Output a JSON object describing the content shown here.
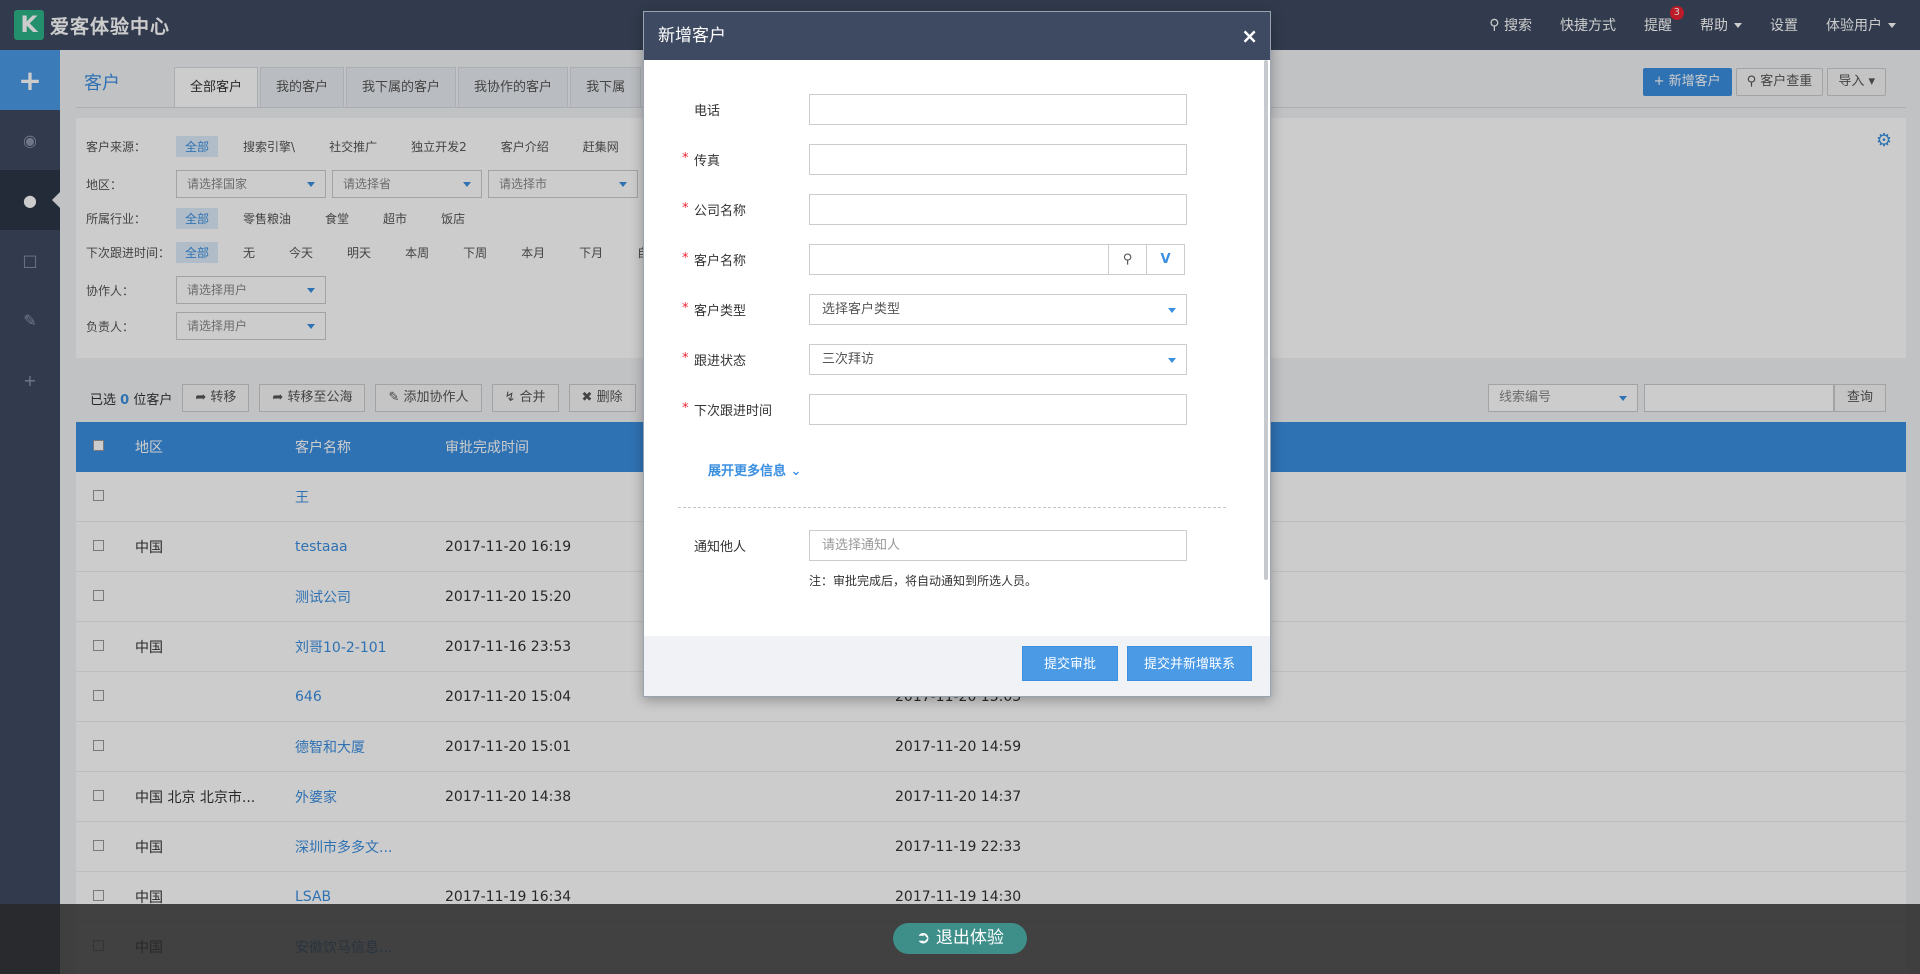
{
  "app": {
    "title": "爱客体验中心",
    "logo_letter": "K"
  },
  "topnav": {
    "search": "搜索",
    "shortcut": "快捷方式",
    "remind": "提醒",
    "remind_count": "3",
    "help": "帮助",
    "settings": "设置",
    "user": "体验用户"
  },
  "page": {
    "title": "客户",
    "tabs": [
      "全部客户",
      "我的客户",
      "我下属的客户",
      "我协作的客户",
      "我下属"
    ],
    "buttons": {
      "new": "新增客户",
      "dup": "客户查重",
      "import": "导入"
    }
  },
  "filters": {
    "source": {
      "label": "客户来源：",
      "options": [
        "全部",
        "搜索引擎\\",
        "社交推广",
        "独立开发2",
        "客户介绍",
        "赶集网"
      ]
    },
    "region": {
      "label": "地区：",
      "country": "请选择国家",
      "province": "请选择省",
      "city": "请选择市"
    },
    "industry": {
      "label": "所属行业：",
      "options": [
        "全部",
        "零售粮油",
        "食堂",
        "超市",
        "饭店"
      ]
    },
    "next": {
      "label": "下次跟进时间：",
      "options": [
        "全部",
        "无",
        "今天",
        "明天",
        "本周",
        "下周",
        "本月",
        "下月",
        "自"
      ]
    },
    "collab": {
      "label": "协作人：",
      "placeholder": "请选择用户"
    },
    "owner": {
      "label": "负责人：",
      "placeholder": "请选择用户"
    }
  },
  "toolbar": {
    "selected_pre": "已选",
    "selected_count": "0",
    "selected_post": "位客户",
    "transfer": "转移",
    "to_pool": "转移至公海",
    "add_collab": "添加协作人",
    "merge": "合并",
    "delete": "删除",
    "search_field": "线索编号",
    "query": "查询"
  },
  "table": {
    "headers": [
      "地区",
      "客户名称",
      "审批完成时间"
    ],
    "rows": [
      {
        "region": "",
        "name": "王",
        "time": "",
        "time2": ""
      },
      {
        "region": "中国",
        "name": "testaaa",
        "time": "2017-11-20 16:19",
        "time2": ""
      },
      {
        "region": "",
        "name": "测试公司",
        "time": "2017-11-20 15:20",
        "time2": ""
      },
      {
        "region": "中国",
        "name": "刘哥10-2-101",
        "time": "2017-11-16 23:53",
        "time2": ""
      },
      {
        "region": "",
        "name": "646",
        "time": "2017-11-20 15:04",
        "time2": "2017-11-20 15:03"
      },
      {
        "region": "",
        "name": "德智和大厦",
        "time": "2017-11-20 15:01",
        "time2": "2017-11-20 14:59"
      },
      {
        "region": "中国 北京 北京市...",
        "name": "外婆家",
        "time": "2017-11-20 14:38",
        "time2": "2017-11-20 14:37"
      },
      {
        "region": "中国",
        "name": "深圳市多多文...",
        "time": "",
        "time2": "2017-11-19 22:33"
      },
      {
        "region": "中国",
        "name": "LSAB",
        "time": "2017-11-19 16:34",
        "time2": "2017-11-19 14:30"
      },
      {
        "region": "中国",
        "name": "安徽饮马信息...",
        "time": "",
        "time2": ""
      }
    ]
  },
  "modal": {
    "title": "新增客户",
    "close": "×",
    "fields": {
      "phone": "电话",
      "fax": "传真",
      "company": "公司名称",
      "customer": "客户名称",
      "type": "客户类型",
      "type_value": "选择客户类型",
      "status": "跟进状态",
      "status_value": "三次拜访",
      "next": "下次跟进时间"
    },
    "more": "展开更多信息",
    "notify_label": "通知他人",
    "notify_placeholder": "请选择通知人",
    "note": "注：审批完成后，将自动通知到所选人员。",
    "submit": "提交审批",
    "submit_contact": "提交并新增联系"
  },
  "exit": "退出体验"
}
